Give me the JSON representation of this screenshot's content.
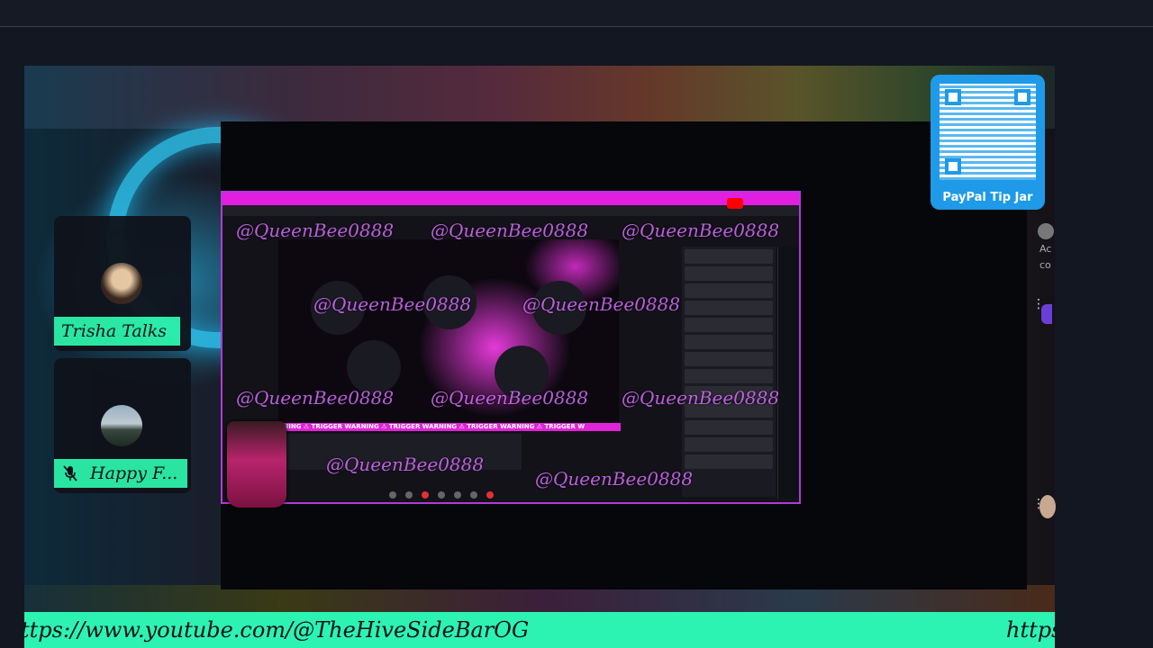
{
  "stream": {
    "ticker_text": "ttps://www.youtube.com/@TheHiveSideBarOG",
    "ticker_text_right": "https"
  },
  "participants": [
    {
      "name": "Trisha Talks",
      "muted": false
    },
    {
      "name": "Happy F...",
      "muted": true
    }
  ],
  "tipjar": {
    "label": "PayPal Tip Jar"
  },
  "screen_share": {
    "watermark": "@QueenBee0888",
    "banner": "RNING  ⚠ TRIGGER WARNING  ⚠ TRIGGER WARNING  ⚠ TRIGGER WARNING  ⚠ TRIGGER W",
    "chat_count": 13
  },
  "right_panel": {
    "text1": "Ac",
    "text2": "co"
  },
  "colors": {
    "accent_green": "#2cf3b2",
    "accent_magenta": "#e21ee0",
    "paypal_blue": "#1e9ae8"
  },
  "icons": [
    "mic-off-icon",
    "qr-code-icon",
    "youtube-icon"
  ]
}
